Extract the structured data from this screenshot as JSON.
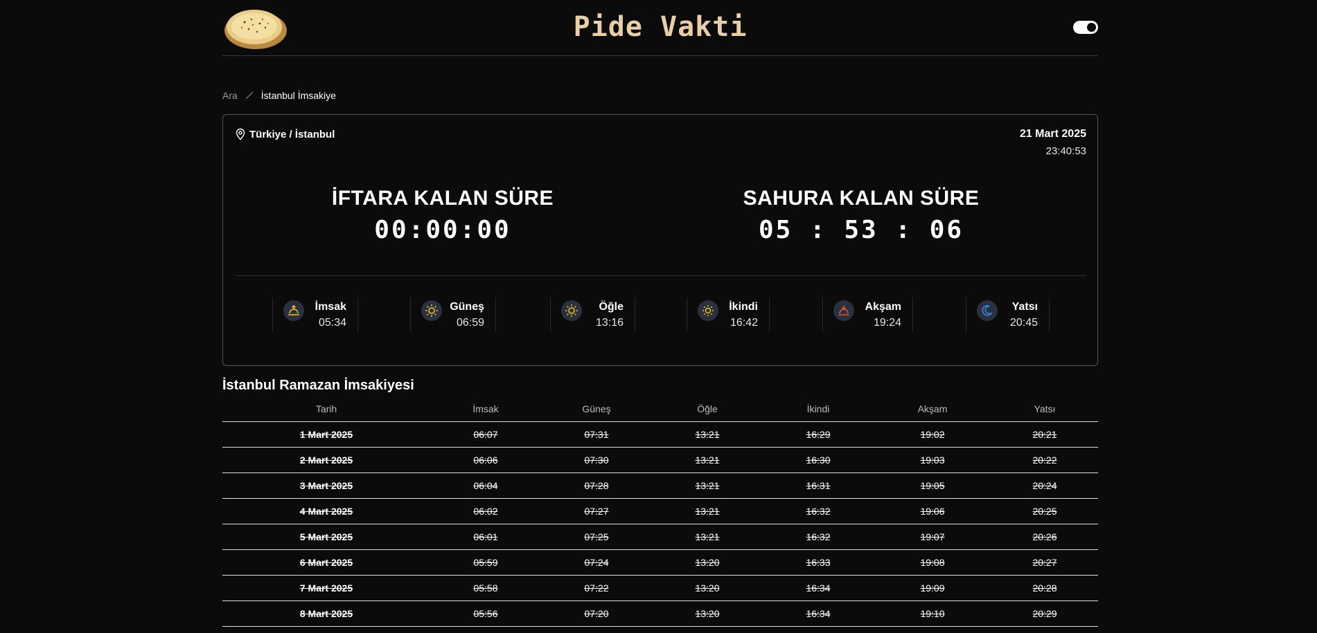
{
  "header": {
    "title": "Pide Vakti",
    "theme_toggle": "dark-mode-toggle"
  },
  "breadcrumb": {
    "home": "Ara",
    "current": "İstanbul İmsakiye"
  },
  "card": {
    "location": "Türkiye / İstanbul",
    "date": "21 Mart 2025",
    "clock": "23:40:53",
    "iftar": {
      "title": "İFTARA KALAN SÜRE",
      "time": "00:00:00"
    },
    "sahur": {
      "title": "SAHURA KALAN SÜRE",
      "time": "05 : 53 : 06"
    }
  },
  "prayer_times": [
    {
      "name": "İmsak",
      "time": "05:34",
      "icon": "sunrise-icon",
      "color": "#f5c518"
    },
    {
      "name": "Güneş",
      "time": "06:59",
      "icon": "sun-icon",
      "color": "#f5c518"
    },
    {
      "name": "Öğle",
      "time": "13:16",
      "icon": "sun-icon",
      "color": "#f5c518"
    },
    {
      "name": "İkindi",
      "time": "16:42",
      "icon": "sun-icon",
      "color": "#f5c518"
    },
    {
      "name": "Akşam",
      "time": "19:24",
      "icon": "sunset-icon",
      "color": "#e8582a"
    },
    {
      "name": "Yatsı",
      "time": "20:45",
      "icon": "moon-icon",
      "color": "#2f8fe8"
    }
  ],
  "table": {
    "title": "İstanbul Ramazan İmsakiyesi",
    "columns": [
      "Tarih",
      "İmsak",
      "Güneş",
      "Öğle",
      "İkindi",
      "Akşam",
      "Yatsı"
    ],
    "rows": [
      [
        "1 Mart 2025",
        "06:07",
        "07:31",
        "13:21",
        "16:29",
        "19:02",
        "20:21"
      ],
      [
        "2 Mart 2025",
        "06:06",
        "07:30",
        "13:21",
        "16:30",
        "19:03",
        "20:22"
      ],
      [
        "3 Mart 2025",
        "06:04",
        "07:28",
        "13:21",
        "16:31",
        "19:05",
        "20:24"
      ],
      [
        "4 Mart 2025",
        "06:02",
        "07:27",
        "13:21",
        "16:32",
        "19:06",
        "20:25"
      ],
      [
        "5 Mart 2025",
        "06:01",
        "07:25",
        "13:21",
        "16:32",
        "19:07",
        "20:26"
      ],
      [
        "6 Mart 2025",
        "05:59",
        "07:24",
        "13:20",
        "16:33",
        "19:08",
        "20:27"
      ],
      [
        "7 Mart 2025",
        "05:58",
        "07:22",
        "13:20",
        "16:34",
        "19:09",
        "20:28"
      ],
      [
        "8 Mart 2025",
        "05:56",
        "07:20",
        "13:20",
        "16:34",
        "19:10",
        "20:29"
      ]
    ]
  }
}
